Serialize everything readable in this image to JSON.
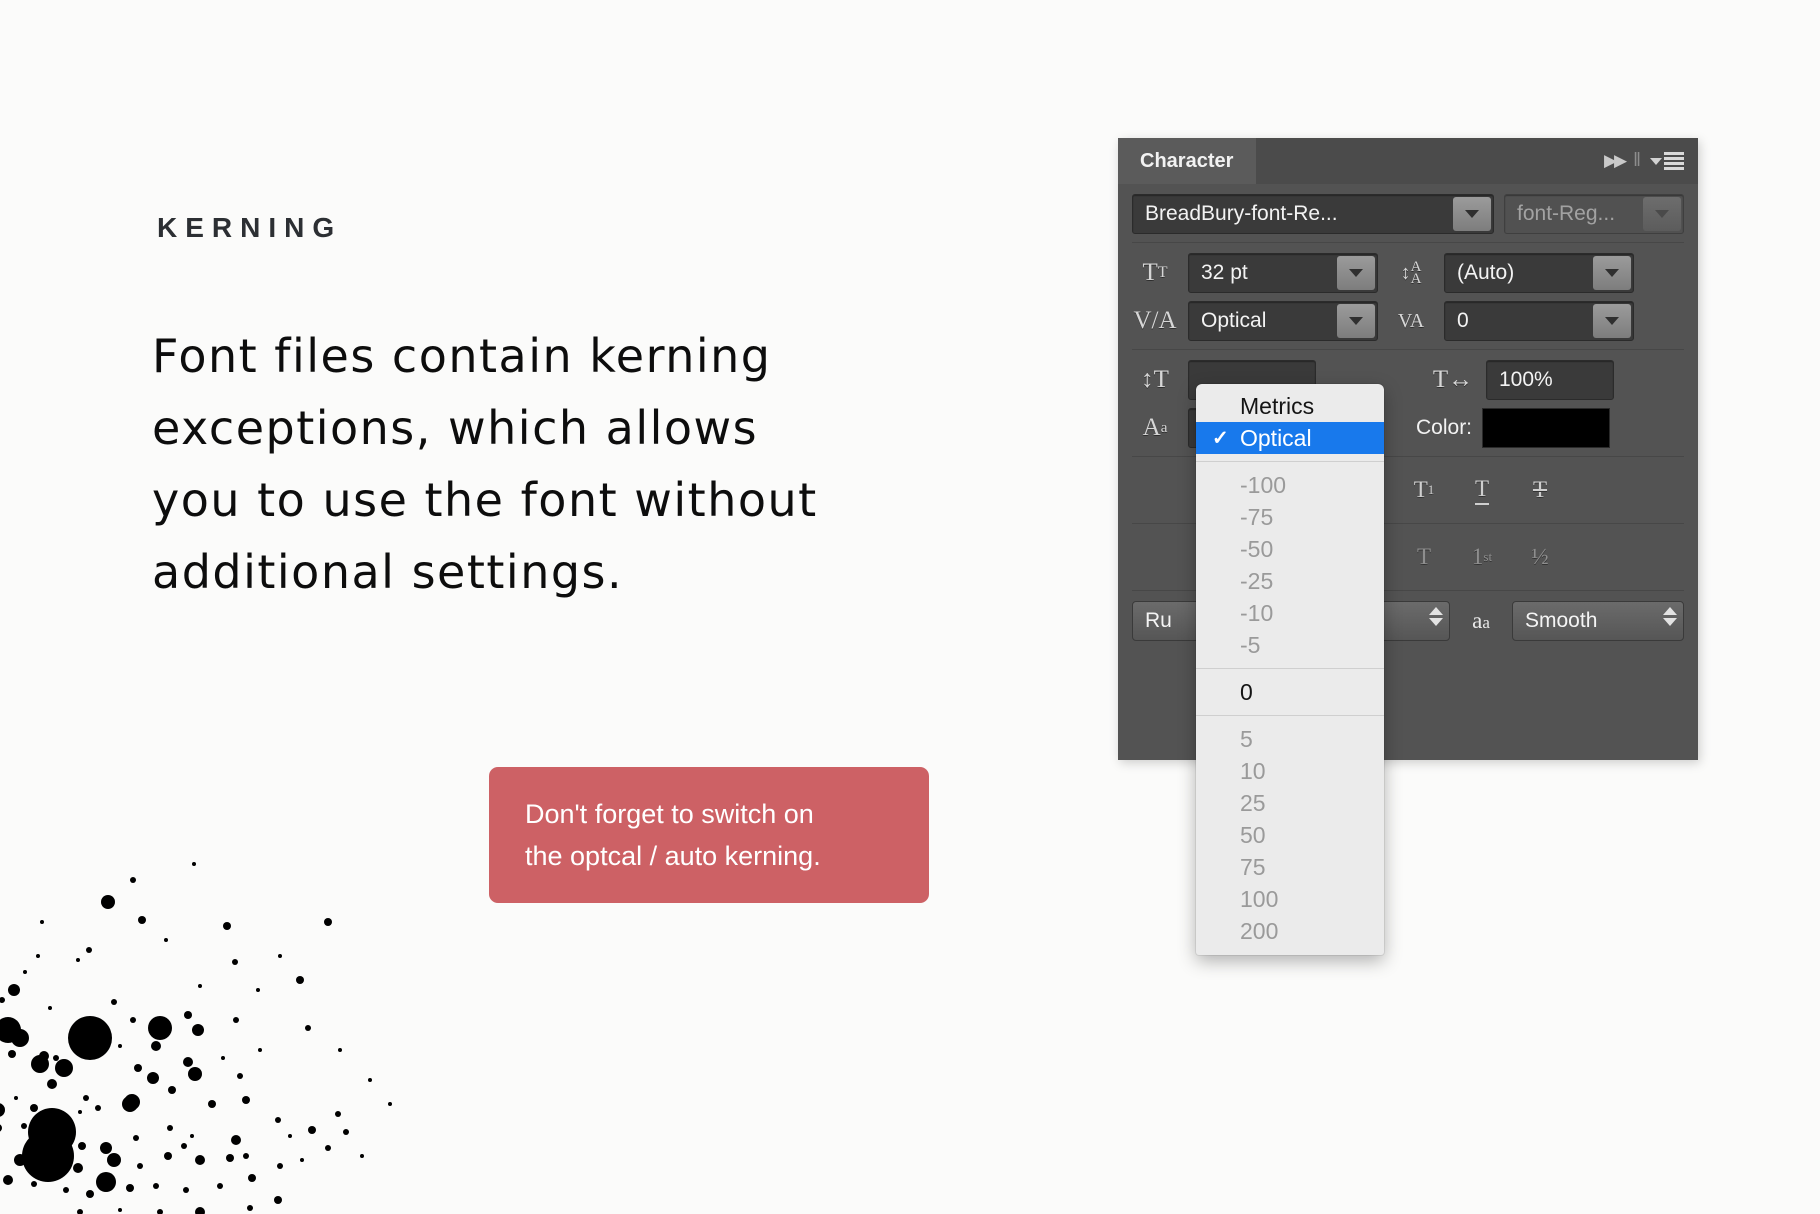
{
  "page": {
    "background_color": "#fbfbfa",
    "title": "KERNING",
    "body_lines": [
      "Font files contain kerning",
      "exceptions, which allows",
      "you to use the font without",
      "additional settings."
    ]
  },
  "callout": {
    "background_color": "#cd6165",
    "text_color": "#ffffff",
    "lines": [
      "Don't forget to switch on",
      "the optcal / auto kerning."
    ]
  },
  "character_panel": {
    "tab_label": "Character",
    "titlebar_icons": {
      "collapse": "▶▶",
      "divider": "‖",
      "menu_caret": "chevron-down-icon",
      "menu_bars": "hamburger-menu-icon"
    },
    "font_family": {
      "icon": "font-family-icon",
      "value": "BreadBury-font-Re...",
      "enabled": true
    },
    "font_style": {
      "value": "font-Reg...",
      "enabled": false
    },
    "font_size": {
      "icon": "TT",
      "label": "font-size",
      "value": "32 pt"
    },
    "leading": {
      "icon": "A̲A",
      "label": "leading",
      "value": "(Auto)"
    },
    "kerning": {
      "icon": "V/A",
      "label": "kerning",
      "value": "Optical"
    },
    "tracking": {
      "icon": "VA",
      "label": "tracking",
      "value": "0"
    },
    "vertical_scale": {
      "icon": "vertical-scale-icon",
      "value": ""
    },
    "baseline_shift": {
      "icon": "baseline-shift-icon",
      "value": ""
    },
    "horizontal_scale": {
      "icon": "horizontal-scale-icon",
      "value": "100%"
    },
    "color": {
      "label": "Color:",
      "swatch_hex": "#000000"
    },
    "style_buttons": [
      {
        "name": "faux-bold",
        "glyph": "T",
        "state": "partial"
      },
      {
        "name": "superscript",
        "glyph": "T",
        "sup": "1"
      },
      {
        "name": "subscript",
        "glyph": "T",
        "sub": "1"
      },
      {
        "name": "underline",
        "glyph": "T"
      },
      {
        "name": "strikethrough",
        "glyph": "T"
      }
    ],
    "opentype_buttons": [
      {
        "name": "swash",
        "glyph": "A"
      },
      {
        "name": "contextual-alternates",
        "glyph": "aa"
      },
      {
        "name": "titling-alternates",
        "glyph": "T"
      },
      {
        "name": "ordinals",
        "glyph": "1",
        "sup": "st"
      },
      {
        "name": "fractions",
        "glyph": "½"
      }
    ],
    "language": {
      "value": "Ru"
    },
    "anti_alias": {
      "icon": "aa",
      "value": "Smooth"
    }
  },
  "kerning_dropdown": {
    "selected": "Optical",
    "selected_color": "#1879ec",
    "groups": [
      {
        "items": [
          {
            "label": "Metrics",
            "emphasis": "strong",
            "checked": false
          },
          {
            "label": "Optical",
            "emphasis": "strong",
            "checked": true
          }
        ]
      },
      {
        "items": [
          {
            "label": "-100",
            "emphasis": "dim",
            "checked": false
          },
          {
            "label": "-75",
            "emphasis": "dim",
            "checked": false
          },
          {
            "label": "-50",
            "emphasis": "dim",
            "checked": false
          },
          {
            "label": "-25",
            "emphasis": "dim",
            "checked": false
          },
          {
            "label": "-10",
            "emphasis": "dim",
            "checked": false
          },
          {
            "label": "-5",
            "emphasis": "dim",
            "checked": false
          }
        ]
      },
      {
        "items": [
          {
            "label": "0",
            "emphasis": "strong",
            "checked": false
          }
        ]
      },
      {
        "items": [
          {
            "label": "5",
            "emphasis": "dim",
            "checked": false
          },
          {
            "label": "10",
            "emphasis": "dim",
            "checked": false
          },
          {
            "label": "25",
            "emphasis": "dim",
            "checked": false
          },
          {
            "label": "50",
            "emphasis": "dim",
            "checked": false
          },
          {
            "label": "75",
            "emphasis": "dim",
            "checked": false
          },
          {
            "label": "100",
            "emphasis": "dim",
            "checked": false
          },
          {
            "label": "200",
            "emphasis": "dim",
            "checked": false
          }
        ]
      }
    ]
  },
  "ink_splatter": {
    "color": "#000000",
    "dots": [
      [
        118,
        42,
        7
      ],
      [
        143,
        20,
        3
      ],
      [
        204,
        4,
        2
      ],
      [
        4,
        62,
        3
      ],
      [
        52,
        62,
        2
      ],
      [
        152,
        60,
        4
      ],
      [
        237,
        66,
        4
      ],
      [
        99,
        90,
        3
      ],
      [
        176,
        80,
        2
      ],
      [
        245,
        102,
        3
      ],
      [
        338,
        62,
        4
      ],
      [
        310,
        120,
        4
      ],
      [
        48,
        96,
        2
      ],
      [
        88,
        100,
        2
      ],
      [
        170,
        168,
        12
      ],
      [
        198,
        155,
        4
      ],
      [
        208,
        170,
        6
      ],
      [
        246,
        160,
        3
      ],
      [
        166,
        186,
        5
      ],
      [
        35,
        112,
        2
      ],
      [
        12,
        140,
        3
      ],
      [
        24,
        130,
        6
      ],
      [
        60,
        148,
        2
      ],
      [
        124,
        142,
        3
      ],
      [
        143,
        160,
        3
      ],
      [
        18,
        170,
        13
      ],
      [
        30,
        178,
        9
      ],
      [
        100,
        178,
        22
      ],
      [
        54,
        196,
        5
      ],
      [
        22,
        194,
        4
      ],
      [
        66,
        198,
        3
      ],
      [
        50,
        204,
        9
      ],
      [
        74,
        208,
        9
      ],
      [
        148,
        208,
        4
      ],
      [
        198,
        202,
        5
      ],
      [
        163,
        218,
        6
      ],
      [
        205,
        214,
        7
      ],
      [
        62,
        224,
        5
      ],
      [
        182,
        230,
        4
      ],
      [
        26,
        238,
        2
      ],
      [
        96,
        238,
        3
      ],
      [
        142,
        242,
        8
      ],
      [
        250,
        216,
        3
      ],
      [
        233,
        198,
        2
      ],
      [
        270,
        190,
        2
      ],
      [
        8,
        250,
        7
      ],
      [
        44,
        248,
        4
      ],
      [
        90,
        252,
        2
      ],
      [
        108,
        248,
        3
      ],
      [
        140,
        244,
        8
      ],
      [
        222,
        244,
        4
      ],
      [
        256,
        240,
        4
      ],
      [
        8,
        268,
        4
      ],
      [
        34,
        266,
        3
      ],
      [
        62,
        272,
        24
      ],
      [
        92,
        286,
        4
      ],
      [
        116,
        288,
        6
      ],
      [
        146,
        278,
        3
      ],
      [
        180,
        268,
        3
      ],
      [
        194,
        286,
        3
      ],
      [
        202,
        276,
        2
      ],
      [
        246,
        280,
        5
      ],
      [
        256,
        296,
        3
      ],
      [
        288,
        260,
        3
      ],
      [
        300,
        276,
        2
      ],
      [
        322,
        270,
        4
      ],
      [
        348,
        254,
        3
      ],
      [
        30,
        300,
        6
      ],
      [
        58,
        296,
        26
      ],
      [
        88,
        308,
        5
      ],
      [
        124,
        300,
        7
      ],
      [
        150,
        306,
        3
      ],
      [
        178,
        296,
        4
      ],
      [
        210,
        300,
        5
      ],
      [
        240,
        298,
        4
      ],
      [
        116,
        322,
        10
      ],
      [
        140,
        328,
        4
      ],
      [
        166,
        326,
        3
      ],
      [
        196,
        330,
        3
      ],
      [
        230,
        326,
        3
      ],
      [
        262,
        318,
        4
      ],
      [
        290,
        306,
        3
      ],
      [
        312,
        300,
        2
      ],
      [
        18,
        320,
        5
      ],
      [
        44,
        324,
        3
      ],
      [
        76,
        330,
        3
      ],
      [
        100,
        334,
        4
      ],
      [
        338,
        288,
        3
      ],
      [
        356,
        272,
        3
      ],
      [
        372,
        296,
        2
      ],
      [
        6,
        200,
        3
      ],
      [
        130,
        186,
        2
      ],
      [
        210,
        126,
        2
      ],
      [
        268,
        130,
        2
      ],
      [
        290,
        96,
        2
      ],
      [
        318,
        168,
        3
      ],
      [
        350,
        190,
        2
      ],
      [
        380,
        220,
        2
      ],
      [
        400,
        244,
        2
      ],
      [
        260,
        348,
        3
      ],
      [
        288,
        340,
        4
      ],
      [
        210,
        352,
        5
      ],
      [
        170,
        352,
        3
      ],
      [
        130,
        350,
        2
      ],
      [
        90,
        352,
        3
      ]
    ]
  }
}
